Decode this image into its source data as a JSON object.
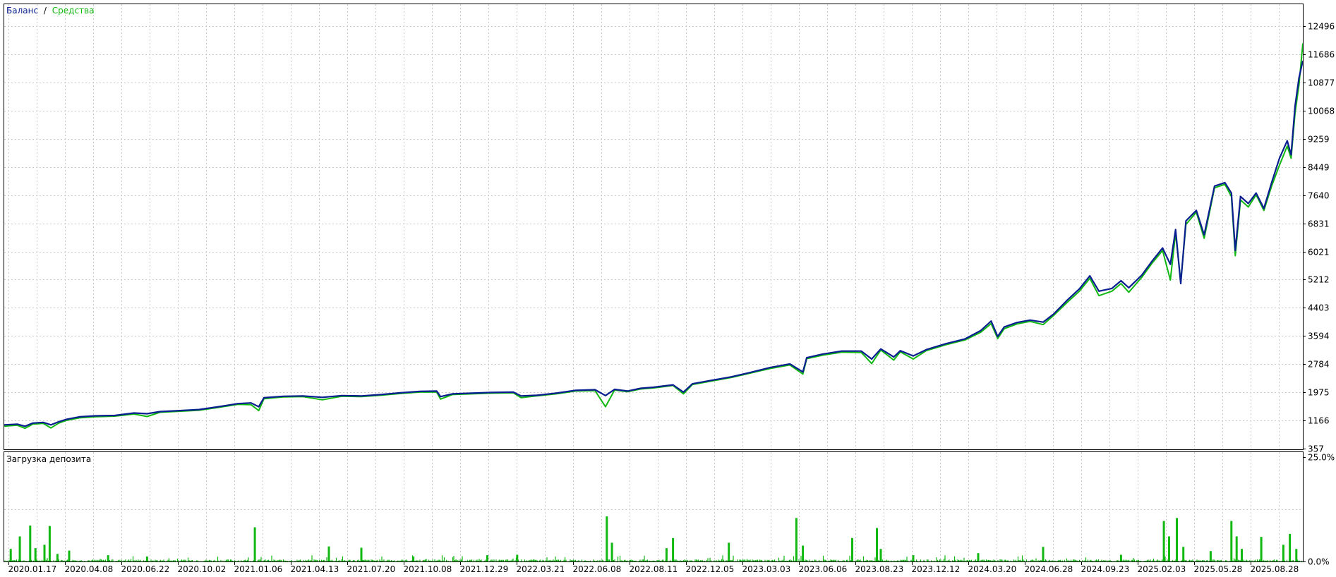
{
  "colors": {
    "balance": "#0a1f8f",
    "equity": "#11b811",
    "load": "#11b811",
    "grid": "#c8c8c8",
    "frame": "#000000",
    "background": "#ffffff"
  },
  "chart_data": [
    {
      "type": "line",
      "legend": {
        "placement": "top-left",
        "entries": [
          "Баланс",
          "Средства"
        ],
        "separator": "/"
      },
      "y_ticks": [
        "12496",
        "11686",
        "10877",
        "10068",
        "9259",
        "8449",
        "7640",
        "6831",
        "6021",
        "5212",
        "4403",
        "3594",
        "2784",
        "1975",
        "1166",
        "357"
      ],
      "ylim": [
        357,
        12496
      ],
      "grid": true,
      "series": [
        {
          "name": "Баланс",
          "points": [
            [
              0.0,
              1040
            ],
            [
              0.01,
              1060
            ],
            [
              0.016,
              1000
            ],
            [
              0.022,
              1090
            ],
            [
              0.03,
              1110
            ],
            [
              0.036,
              1040
            ],
            [
              0.042,
              1130
            ],
            [
              0.048,
              1200
            ],
            [
              0.058,
              1270
            ],
            [
              0.07,
              1300
            ],
            [
              0.085,
              1310
            ],
            [
              0.1,
              1380
            ],
            [
              0.11,
              1360
            ],
            [
              0.12,
              1420
            ],
            [
              0.135,
              1450
            ],
            [
              0.15,
              1480
            ],
            [
              0.165,
              1560
            ],
            [
              0.18,
              1650
            ],
            [
              0.19,
              1670
            ],
            [
              0.196,
              1560
            ],
            [
              0.2,
              1820
            ],
            [
              0.215,
              1860
            ],
            [
              0.23,
              1870
            ],
            [
              0.245,
              1830
            ],
            [
              0.26,
              1880
            ],
            [
              0.275,
              1870
            ],
            [
              0.29,
              1910
            ],
            [
              0.305,
              1960
            ],
            [
              0.32,
              2000
            ],
            [
              0.333,
              2010
            ],
            [
              0.336,
              1850
            ],
            [
              0.345,
              1930
            ],
            [
              0.36,
              1950
            ],
            [
              0.375,
              1970
            ],
            [
              0.392,
              1980
            ],
            [
              0.398,
              1870
            ],
            [
              0.41,
              1890
            ],
            [
              0.425,
              1950
            ],
            [
              0.44,
              2030
            ],
            [
              0.455,
              2050
            ],
            [
              0.463,
              1880
            ],
            [
              0.47,
              2060
            ],
            [
              0.48,
              2010
            ],
            [
              0.49,
              2090
            ],
            [
              0.5,
              2120
            ],
            [
              0.515,
              2190
            ],
            [
              0.523,
              1980
            ],
            [
              0.53,
              2220
            ],
            [
              0.545,
              2320
            ],
            [
              0.56,
              2420
            ],
            [
              0.575,
              2550
            ],
            [
              0.59,
              2690
            ],
            [
              0.605,
              2790
            ],
            [
              0.615,
              2560
            ],
            [
              0.618,
              2970
            ],
            [
              0.63,
              3070
            ],
            [
              0.645,
              3160
            ],
            [
              0.66,
              3160
            ],
            [
              0.668,
              2930
            ],
            [
              0.675,
              3220
            ],
            [
              0.685,
              2990
            ],
            [
              0.69,
              3170
            ],
            [
              0.7,
              3020
            ],
            [
              0.71,
              3200
            ],
            [
              0.725,
              3370
            ],
            [
              0.74,
              3510
            ],
            [
              0.752,
              3750
            ],
            [
              0.76,
              4020
            ],
            [
              0.765,
              3580
            ],
            [
              0.77,
              3850
            ],
            [
              0.78,
              3980
            ],
            [
              0.79,
              4050
            ],
            [
              0.8,
              3990
            ],
            [
              0.808,
              4220
            ],
            [
              0.818,
              4600
            ],
            [
              0.828,
              4950
            ],
            [
              0.836,
              5320
            ],
            [
              0.843,
              4880
            ],
            [
              0.853,
              4960
            ],
            [
              0.86,
              5180
            ],
            [
              0.866,
              4980
            ],
            [
              0.876,
              5340
            ],
            [
              0.884,
              5750
            ],
            [
              0.892,
              6120
            ],
            [
              0.898,
              5650
            ],
            [
              0.902,
              6650
            ],
            [
              0.906,
              5100
            ],
            [
              0.91,
              6900
            ],
            [
              0.918,
              7200
            ],
            [
              0.924,
              6500
            ],
            [
              0.932,
              7900
            ],
            [
              0.94,
              8000
            ],
            [
              0.945,
              7700
            ],
            [
              0.948,
              6050
            ],
            [
              0.952,
              7600
            ],
            [
              0.958,
              7400
            ],
            [
              0.964,
              7700
            ],
            [
              0.97,
              7260
            ],
            [
              0.976,
              8000
            ],
            [
              0.982,
              8700
            ],
            [
              0.988,
              9200
            ],
            [
              0.991,
              8800
            ],
            [
              0.994,
              10200
            ],
            [
              0.997,
              11000
            ],
            [
              1.0,
              11500
            ]
          ]
        },
        {
          "name": "Средства",
          "points": [
            [
              0.0,
              1000
            ],
            [
              0.01,
              1030
            ],
            [
              0.016,
              940
            ],
            [
              0.022,
              1060
            ],
            [
              0.03,
              1080
            ],
            [
              0.036,
              950
            ],
            [
              0.042,
              1090
            ],
            [
              0.048,
              1170
            ],
            [
              0.058,
              1240
            ],
            [
              0.07,
              1270
            ],
            [
              0.085,
              1290
            ],
            [
              0.1,
              1350
            ],
            [
              0.11,
              1280
            ],
            [
              0.12,
              1400
            ],
            [
              0.135,
              1430
            ],
            [
              0.15,
              1460
            ],
            [
              0.165,
              1540
            ],
            [
              0.18,
              1630
            ],
            [
              0.19,
              1620
            ],
            [
              0.196,
              1450
            ],
            [
              0.2,
              1790
            ],
            [
              0.215,
              1840
            ],
            [
              0.23,
              1850
            ],
            [
              0.245,
              1760
            ],
            [
              0.26,
              1860
            ],
            [
              0.275,
              1850
            ],
            [
              0.29,
              1890
            ],
            [
              0.305,
              1940
            ],
            [
              0.32,
              1980
            ],
            [
              0.333,
              1980
            ],
            [
              0.336,
              1780
            ],
            [
              0.345,
              1910
            ],
            [
              0.36,
              1930
            ],
            [
              0.375,
              1950
            ],
            [
              0.392,
              1960
            ],
            [
              0.398,
              1820
            ],
            [
              0.41,
              1870
            ],
            [
              0.425,
              1930
            ],
            [
              0.44,
              2010
            ],
            [
              0.455,
              2020
            ],
            [
              0.463,
              1560
            ],
            [
              0.47,
              2040
            ],
            [
              0.48,
              1990
            ],
            [
              0.49,
              2070
            ],
            [
              0.5,
              2100
            ],
            [
              0.515,
              2170
            ],
            [
              0.523,
              1930
            ],
            [
              0.53,
              2200
            ],
            [
              0.545,
              2300
            ],
            [
              0.56,
              2400
            ],
            [
              0.575,
              2530
            ],
            [
              0.59,
              2660
            ],
            [
              0.605,
              2760
            ],
            [
              0.615,
              2500
            ],
            [
              0.618,
              2940
            ],
            [
              0.63,
              3040
            ],
            [
              0.645,
              3130
            ],
            [
              0.66,
              3120
            ],
            [
              0.668,
              2800
            ],
            [
              0.675,
              3190
            ],
            [
              0.685,
              2900
            ],
            [
              0.69,
              3140
            ],
            [
              0.7,
              2930
            ],
            [
              0.71,
              3170
            ],
            [
              0.725,
              3340
            ],
            [
              0.74,
              3480
            ],
            [
              0.752,
              3700
            ],
            [
              0.76,
              3950
            ],
            [
              0.765,
              3520
            ],
            [
              0.77,
              3800
            ],
            [
              0.78,
              3940
            ],
            [
              0.79,
              4010
            ],
            [
              0.8,
              3920
            ],
            [
              0.808,
              4180
            ],
            [
              0.818,
              4540
            ],
            [
              0.828,
              4880
            ],
            [
              0.836,
              5250
            ],
            [
              0.843,
              4750
            ],
            [
              0.853,
              4880
            ],
            [
              0.86,
              5100
            ],
            [
              0.866,
              4850
            ],
            [
              0.876,
              5280
            ],
            [
              0.884,
              5690
            ],
            [
              0.892,
              6050
            ],
            [
              0.898,
              5200
            ],
            [
              0.902,
              6550
            ],
            [
              0.906,
              5150
            ],
            [
              0.91,
              6800
            ],
            [
              0.918,
              7150
            ],
            [
              0.924,
              6400
            ],
            [
              0.932,
              7850
            ],
            [
              0.94,
              7950
            ],
            [
              0.945,
              7600
            ],
            [
              0.948,
              5900
            ],
            [
              0.952,
              7500
            ],
            [
              0.958,
              7300
            ],
            [
              0.964,
              7650
            ],
            [
              0.97,
              7200
            ],
            [
              0.976,
              7900
            ],
            [
              0.982,
              8500
            ],
            [
              0.988,
              9050
            ],
            [
              0.991,
              8700
            ],
            [
              0.994,
              10000
            ],
            [
              0.997,
              10800
            ],
            [
              1.0,
              12000
            ]
          ]
        }
      ]
    },
    {
      "type": "bar",
      "title": "Загрузка депозита",
      "y_ticks": [
        "25.0%",
        "0.0%"
      ],
      "ylim": [
        0,
        25
      ],
      "grid": true,
      "baseline_noise_percent": 0.5,
      "spikes": [
        [
          0.005,
          3
        ],
        [
          0.012,
          6
        ],
        [
          0.02,
          8.6
        ],
        [
          0.024,
          3.2
        ],
        [
          0.031,
          4
        ],
        [
          0.035,
          8.5
        ],
        [
          0.041,
          1.8
        ],
        [
          0.05,
          2.6
        ],
        [
          0.08,
          1.5
        ],
        [
          0.11,
          1.2
        ],
        [
          0.193,
          8.2
        ],
        [
          0.25,
          3.6
        ],
        [
          0.275,
          3.3
        ],
        [
          0.315,
          1.2
        ],
        [
          0.372,
          1.5
        ],
        [
          0.395,
          1.6
        ],
        [
          0.464,
          10.8
        ],
        [
          0.468,
          4.5
        ],
        [
          0.51,
          3.2
        ],
        [
          0.515,
          5.6
        ],
        [
          0.558,
          4.5
        ],
        [
          0.61,
          10.4
        ],
        [
          0.615,
          3.8
        ],
        [
          0.653,
          5.6
        ],
        [
          0.672,
          8.0
        ],
        [
          0.675,
          3.0
        ],
        [
          0.7,
          1.5
        ],
        [
          0.75,
          2.0
        ],
        [
          0.8,
          3.5
        ],
        [
          0.86,
          1.6
        ],
        [
          0.893,
          9.7
        ],
        [
          0.897,
          6.0
        ],
        [
          0.903,
          10.4
        ],
        [
          0.908,
          3.5
        ],
        [
          0.929,
          2.5
        ],
        [
          0.945,
          9.7
        ],
        [
          0.949,
          6.0
        ],
        [
          0.953,
          3.0
        ],
        [
          0.968,
          5.9
        ],
        [
          0.985,
          4.0
        ],
        [
          0.99,
          6.6
        ],
        [
          0.995,
          3.0
        ]
      ]
    }
  ],
  "x_ticks": [
    "2020.01.17",
    "2020.04.08",
    "2020.06.22",
    "2020.10.02",
    "2021.01.06",
    "2021.04.13",
    "2021.07.20",
    "2021.10.08",
    "2021.12.29",
    "2022.03.21",
    "2022.06.08",
    "2022.08.11",
    "2022.12.05",
    "2023.03.03",
    "2023.06.06",
    "2023.08.23",
    "2023.12.12",
    "2024.03.20",
    "2024.06.28",
    "2024.09.23",
    "2025.02.03",
    "2025.05.28",
    "2025.08.28"
  ]
}
